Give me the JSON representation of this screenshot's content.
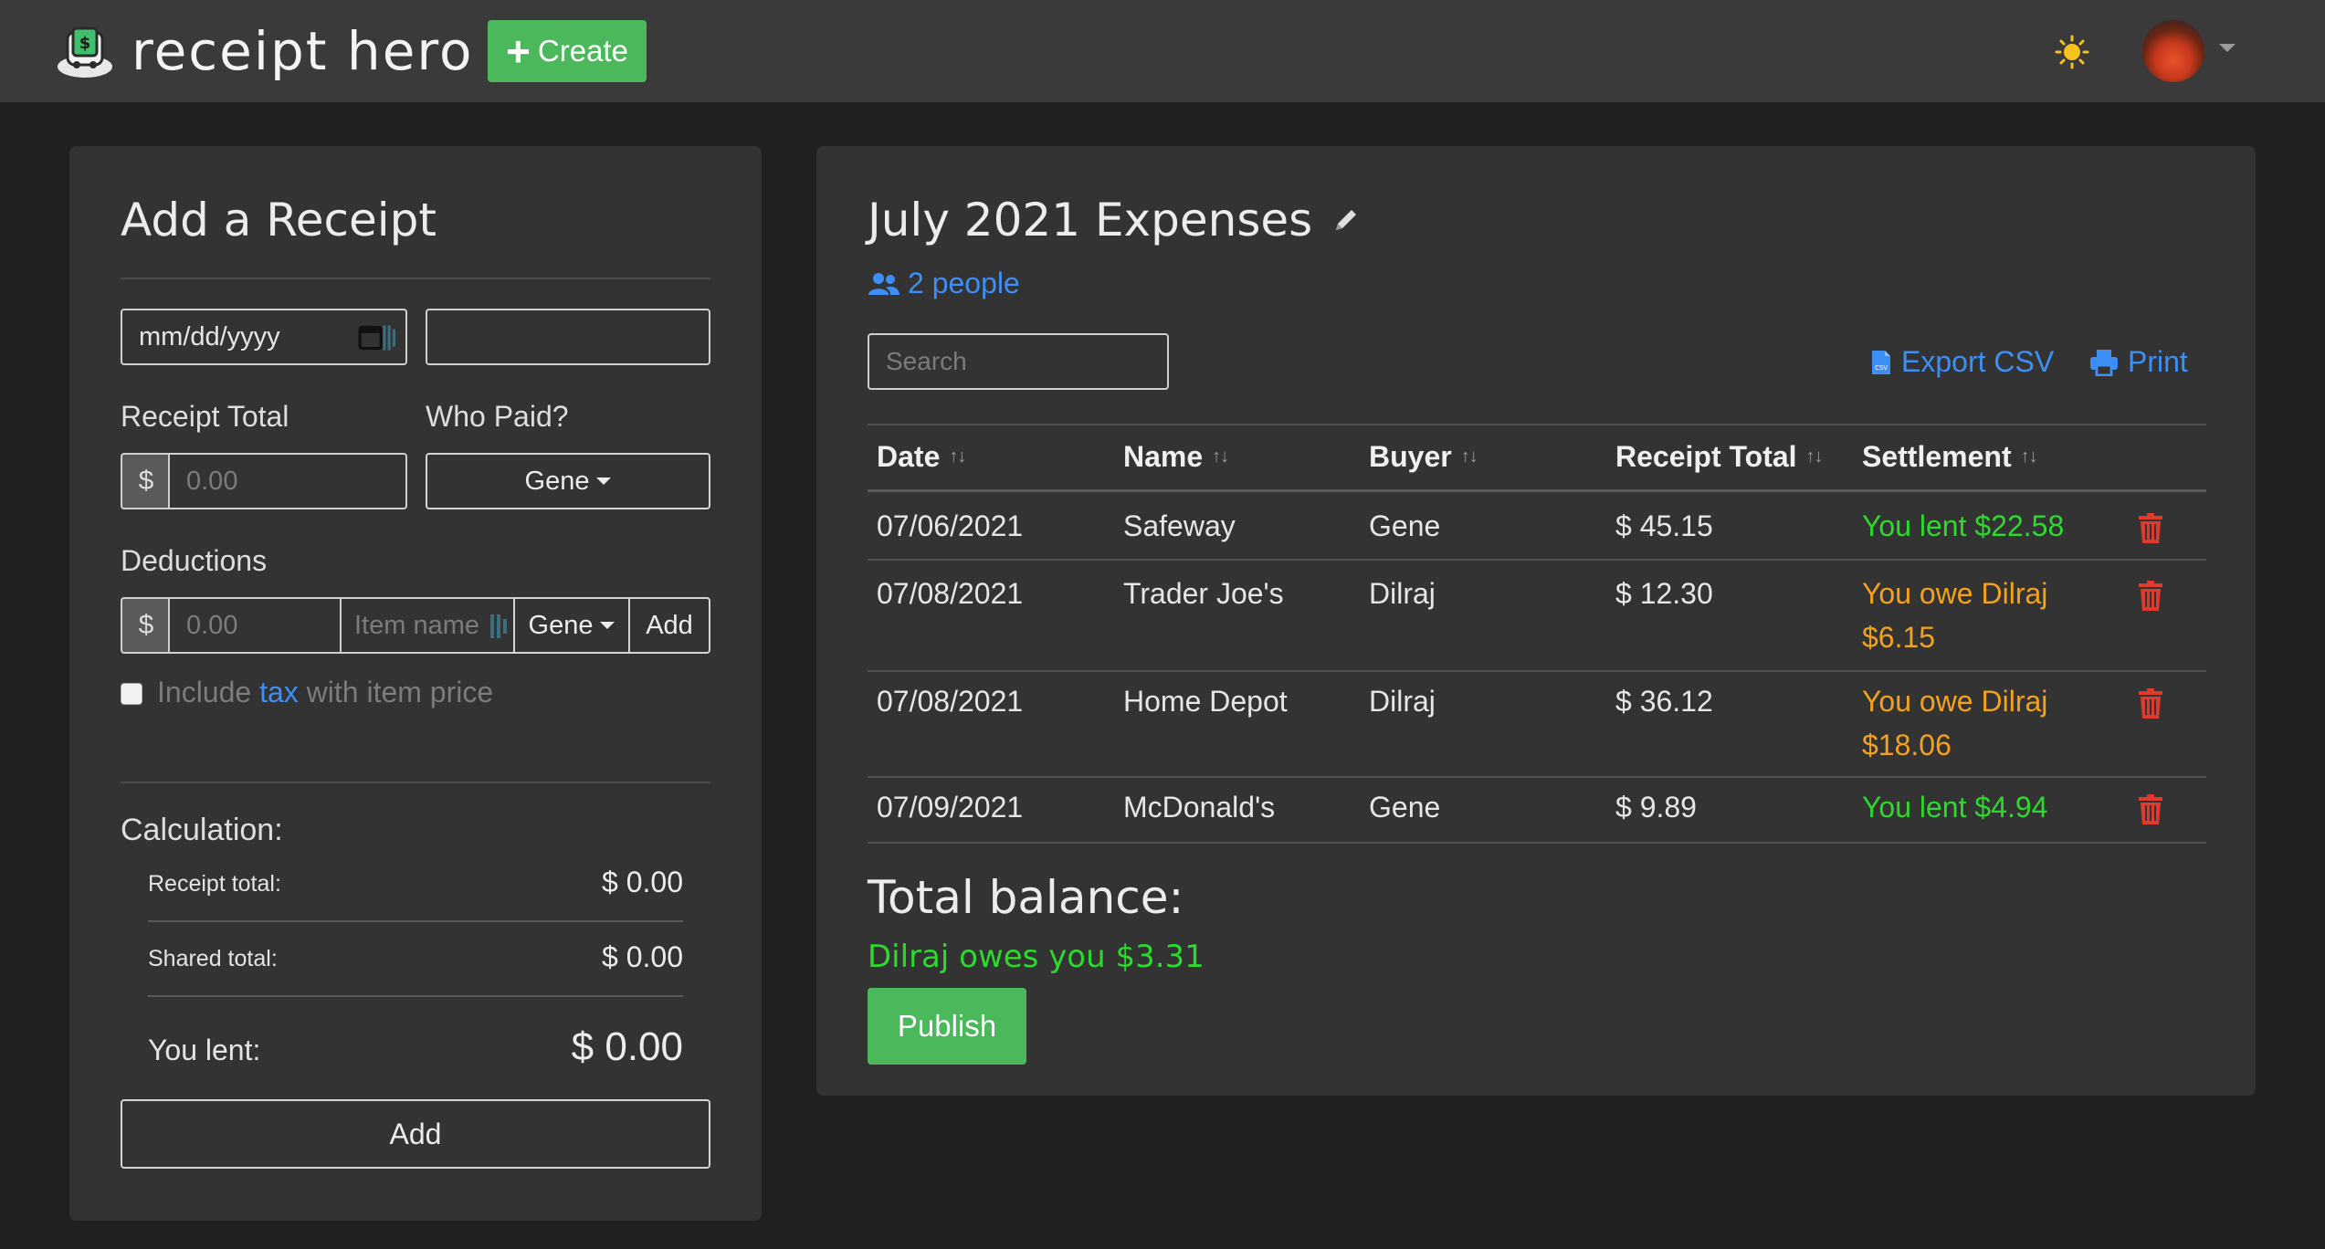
{
  "navbar": {
    "brand": "receipt hero",
    "create_label": "Create"
  },
  "add_receipt": {
    "title": "Add a Receipt",
    "date_placeholder": "mm/dd/yyyy",
    "name_value": "",
    "receipt_total_label": "Receipt Total",
    "who_paid_label": "Who Paid?",
    "currency_symbol": "$",
    "receipt_total_placeholder": "0.00",
    "who_paid_value": "Gene",
    "deductions_label": "Deductions",
    "deduction_amount_placeholder": "0.00",
    "item_name_placeholder": "Item name",
    "deduction_buyer": "Gene",
    "deduction_add_label": "Add",
    "include_label_pre": "Include",
    "include_label_link": "tax",
    "include_label_post": "with item price",
    "calculation_label": "Calculation:",
    "receipt_total_row_label": "Receipt total:",
    "receipt_total_row_value": "$ 0.00",
    "shared_total_row_label": "Shared total:",
    "shared_total_row_value": "$ 0.00",
    "you_lent_label": "You lent:",
    "you_lent_value": "$ 0.00",
    "add_button_label": "Add"
  },
  "sheet": {
    "title": "July 2021 Expenses",
    "people_link": "2 people",
    "search_placeholder": "Search",
    "export_label": "Export CSV",
    "print_label": "Print",
    "columns": [
      "Date",
      "Name",
      "Buyer",
      "Receipt Total",
      "Settlement"
    ],
    "sort_glyph": "↑↓",
    "rows": [
      {
        "date": "07/06/2021",
        "name": "Safeway",
        "buyer": "Gene",
        "total": "$ 45.15",
        "settlement_1": "You lent $22.58",
        "settlement_2": "",
        "status": "green"
      },
      {
        "date": "07/08/2021",
        "name": "Trader Joe's",
        "buyer": "Dilraj",
        "total": "$ 12.30",
        "settlement_1": "You owe Dilraj",
        "settlement_2": "$6.15",
        "status": "orange"
      },
      {
        "date": "07/08/2021",
        "name": "Home Depot",
        "buyer": "Dilraj",
        "total": "$ 36.12",
        "settlement_1": "You owe Dilraj",
        "settlement_2": "$18.06",
        "status": "orange"
      },
      {
        "date": "07/09/2021",
        "name": "McDonald's",
        "buyer": "Gene",
        "total": "$ 9.89",
        "settlement_1": "You lent $4.94",
        "settlement_2": "",
        "status": "green"
      }
    ],
    "total_balance_label": "Total balance:",
    "balance_text": "Dilraj owes you $3.31",
    "publish_label": "Publish"
  },
  "icons": {
    "logo": "receipt-robot-icon",
    "theme": "sun-icon",
    "people": "users-icon",
    "edit": "pencil-icon",
    "export": "csv-file-icon",
    "print": "printer-icon",
    "delete": "trash-icon"
  },
  "colors": {
    "accent_green": "#4cb85c",
    "link_blue": "#3d8ef5",
    "lent_green": "#2ed92e",
    "owe_orange": "#f2a21e",
    "trash_red": "#e03a2f"
  }
}
